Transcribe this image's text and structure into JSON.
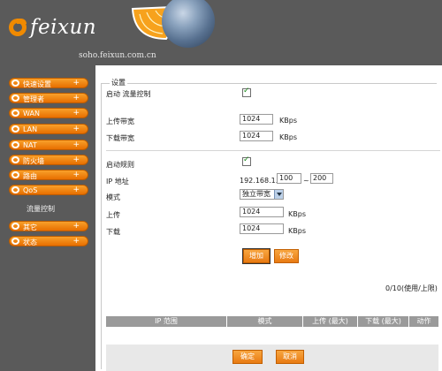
{
  "brand": {
    "name": "feixun",
    "domain": "soho.feixun.com.cn",
    "accent": "#f08a00"
  },
  "sidebar": {
    "items": [
      {
        "label": "快速设置",
        "icon": "plus-icon"
      },
      {
        "label": "管理者",
        "icon": "plus-icon"
      },
      {
        "label": "WAN",
        "icon": "plus-icon"
      },
      {
        "label": "LAN",
        "icon": "plus-icon"
      },
      {
        "label": "NAT",
        "icon": "plus-icon"
      },
      {
        "label": "防火墙",
        "icon": "plus-icon"
      },
      {
        "label": "路由",
        "icon": "plus-icon"
      },
      {
        "label": "QoS",
        "icon": "plus-icon"
      },
      {
        "label": "其它",
        "icon": "plus-icon"
      },
      {
        "label": "状态",
        "icon": "plus-icon"
      }
    ],
    "sub_item": "流量控制"
  },
  "settings": {
    "title": "设置",
    "enable_flow_control": {
      "label": "启动 流量控制",
      "checked": true
    },
    "upload_bandwidth": {
      "label": "上传带宽",
      "value": "1024",
      "unit": "KBps"
    },
    "download_bandwidth": {
      "label": "下载带宽",
      "value": "1024",
      "unit": "KBps"
    }
  },
  "rule": {
    "enable_rule": {
      "label": "启动规则",
      "checked": true
    },
    "ip": {
      "label": "IP 地址",
      "prefix": "192.168.1.",
      "start": "100",
      "separator": "~",
      "end": "200"
    },
    "mode": {
      "label": "模式",
      "value": "独立带宽"
    },
    "upload": {
      "label": "上传",
      "value": "1024",
      "unit": "KBps"
    },
    "download": {
      "label": "下载",
      "value": "1024",
      "unit": "KBps"
    },
    "add_button": "增加",
    "edit_button": "修改",
    "count_text": "0/10(使用/上限)"
  },
  "table": {
    "columns": [
      "IP 范围",
      "模式",
      "上传 (最大)",
      "下载 (最大)",
      "动作"
    ]
  },
  "footer": {
    "confirm_button": "确定",
    "cancel_button": "取消"
  }
}
